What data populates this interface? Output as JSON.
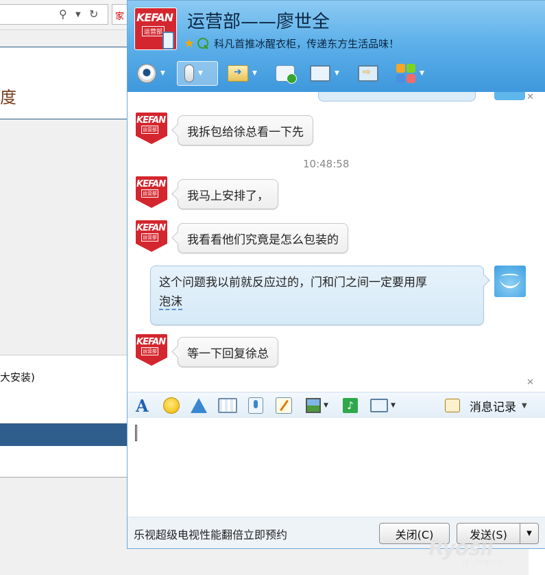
{
  "background": {
    "heading_fragment": "度",
    "section_text": "大安装)",
    "tab_char": "家"
  },
  "chat_window": {
    "contact_name": "运营部——廖世全",
    "avatar_brand": "KEFAN",
    "avatar_dept": "运营部",
    "signature": "科凡首推冰醒衣柜，传递东方生活品味！",
    "messages": [
      {
        "sender": "contact",
        "text": "我拆包给徐总看一下先"
      },
      {
        "type": "time",
        "text": "10:48:58"
      },
      {
        "sender": "contact",
        "text": "我马上安排了，"
      },
      {
        "sender": "contact",
        "text": "我看看他们究竟是怎么包装的"
      },
      {
        "sender": "me",
        "text_line1": "这个问题我以前就反应过的，门和门之间一定要用厚",
        "text_line2": "泡沫"
      },
      {
        "sender": "contact",
        "text": "等一下回复徐总"
      }
    ],
    "input_toolbar": {
      "history_label": "消息记录"
    },
    "footer": {
      "ad_text": "乐视超级电视性能翻倍立即预约",
      "close_label": "关闭(C)",
      "send_label": "发送(S)"
    }
  },
  "watermark": {
    "text": "Ryosii",
    "sub": "瑞江网络社区"
  },
  "colors": {
    "header_top": "#8ccaf3",
    "header_bottom": "#3e98dc",
    "brand_red": "#d4262e",
    "bg_bar": "#2f5d8c"
  }
}
